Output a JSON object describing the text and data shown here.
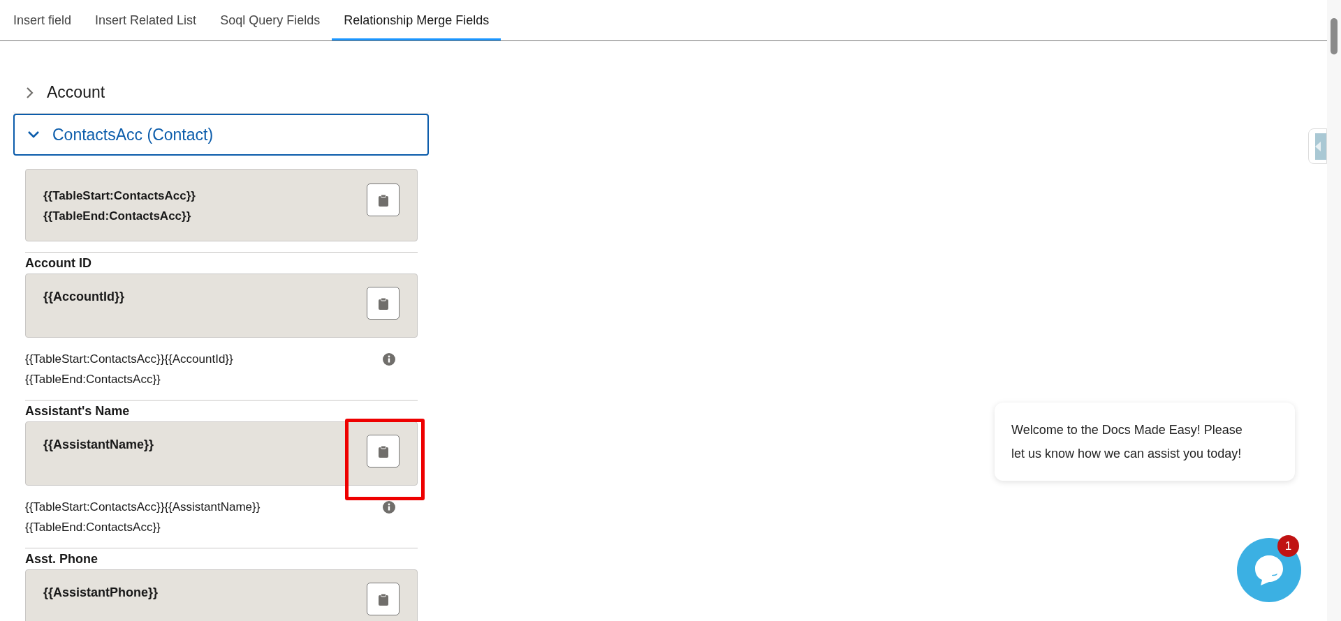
{
  "tabs": [
    {
      "label": "Insert field",
      "selected": false
    },
    {
      "label": "Insert Related List",
      "selected": false
    },
    {
      "label": "Soql Query Fields",
      "selected": false
    },
    {
      "label": "Relationship Merge Fields",
      "selected": true
    }
  ],
  "sections": [
    {
      "label": "Account",
      "expanded": false
    },
    {
      "label": "ContactsAcc (Contact)",
      "expanded": true,
      "table_code": [
        "{{TableStart:ContactsAcc}}",
        "{{TableEnd:ContactsAcc}}"
      ],
      "fields": [
        {
          "label": "Account ID",
          "code": "{{AccountId}}",
          "usage": [
            "{{TableStart:ContactsAcc}}{{AccountId}}",
            "{{TableEnd:ContactsAcc}}"
          ],
          "highlighted": false
        },
        {
          "label": "Assistant's Name",
          "code": "{{AssistantName}}",
          "usage": [
            "{{TableStart:ContactsAcc}}{{AssistantName}}",
            "{{TableEnd:ContactsAcc}}"
          ],
          "highlighted": true
        },
        {
          "label": "Asst. Phone",
          "code": "{{AssistantPhone}}",
          "highlighted": false
        }
      ]
    }
  ],
  "chat": {
    "message": "Welcome to the Docs Made Easy! Please let us know how we can assist you today!",
    "badge": "1"
  }
}
